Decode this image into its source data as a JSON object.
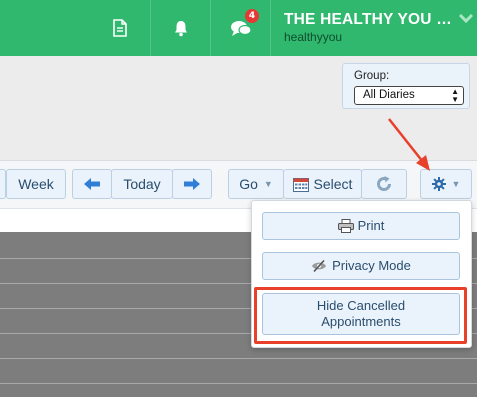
{
  "header": {
    "company_name": "THE HEALTHY YOU C...",
    "username": "healthyyou",
    "notification_count": "4",
    "icons": [
      "document-icon",
      "bell-icon",
      "chat-icon",
      "chevron-down-icon"
    ]
  },
  "group": {
    "label": "Group:",
    "selected": "All Diaries"
  },
  "toolbar": {
    "week_label": "Week",
    "today_label": "Today",
    "go_label": "Go",
    "select_label": "Select"
  },
  "menu": {
    "print_label": "Print",
    "privacy_label": "Privacy Mode",
    "hide_cancelled_label": "Hide Cancelled Appointments"
  },
  "colors": {
    "header_bg": "#2fb86e",
    "button_bg": "#eaf3fb",
    "button_text": "#2a4d6e",
    "highlight": "#e8402a",
    "grid_bg": "#7d7d7d"
  }
}
